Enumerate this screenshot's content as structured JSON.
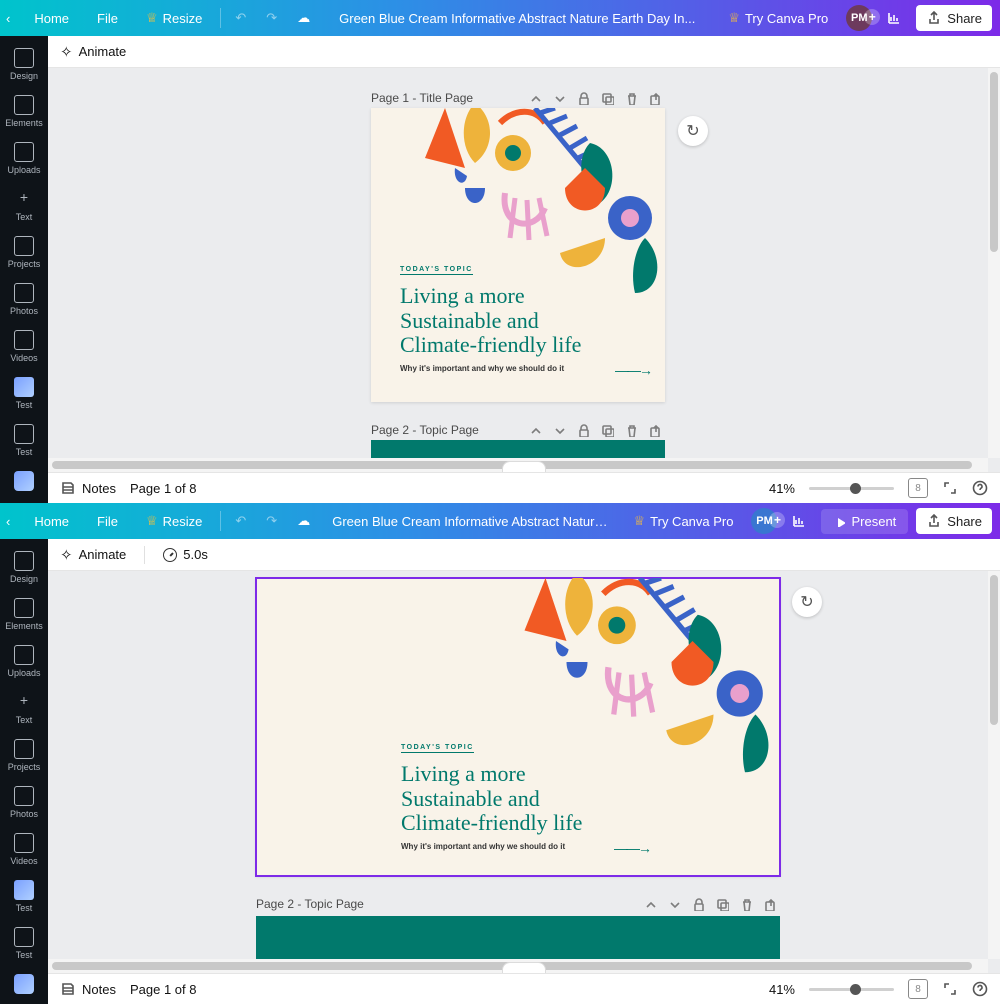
{
  "top": {
    "home": "Home",
    "file": "File",
    "resize": "Resize",
    "title": "Green Blue Cream Informative Abstract Nature Earth Day In...",
    "try": "Try Canva Pro",
    "present": "Present",
    "share": "Share",
    "avatar": "PM"
  },
  "sub": {
    "animate": "Animate",
    "timing": "5.0s"
  },
  "side": {
    "items": [
      "Design",
      "Elements",
      "Uploads",
      "Text",
      "Projects",
      "Photos",
      "Videos",
      "Test",
      "Test"
    ]
  },
  "pages": {
    "p1": "Page 1 - Title Page",
    "p2": "Page 2 - Topic Page"
  },
  "slide": {
    "topic": "TODAY'S TOPIC",
    "h1": "Living a more",
    "h2": "Sustainable and",
    "h3": "Climate-friendly life",
    "sub": "Why it's important and why we should do it"
  },
  "status": {
    "notes": "Notes",
    "page": "Page 1 of 8",
    "zoom": "41%",
    "grid": "8"
  }
}
